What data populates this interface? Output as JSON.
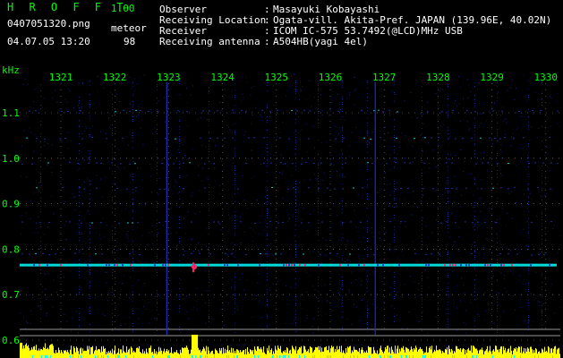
{
  "header": {
    "app_title": "H R O F F T",
    "version": "1.00",
    "filename": "0407051320.png",
    "datetime": "04.07.05 13:20",
    "event_type": "meteor",
    "event_count": "98",
    "info": [
      {
        "label": "Observer",
        "value": "Masayuki Kobayashi"
      },
      {
        "label": "Receiving Location",
        "value": "Ogata-vill. Akita-Pref. JAPAN (139.96E, 40.02N)"
      },
      {
        "label": "Receiver",
        "value": "ICOM IC-575 53.7492(@LCD)MHz USB"
      },
      {
        "label": "Receiving antenna",
        "value": "A504HB(yagi 4el)"
      }
    ],
    "separator": ":"
  },
  "chart_data": {
    "type": "heatmap",
    "x_unit": "time (HHMM)",
    "x_ticks": [
      "1321",
      "1322",
      "1323",
      "1324",
      "1325",
      "1326",
      "1327",
      "1328",
      "1329",
      "1330"
    ],
    "y_unit": "kHz",
    "y_ticks": [
      "1.1",
      "1.0",
      "0.9",
      "0.8",
      "0.7",
      "0.6"
    ],
    "ylim": [
      0.6,
      1.16
    ],
    "carrier_khz": 0.765,
    "meteor_echo_times": [
      "1323",
      "1327"
    ],
    "colors": {
      "background": "#000000",
      "grid": "#ffffff",
      "signal_low": "#2233cc",
      "signal_mid": "#00ffff",
      "signal_high": "#ff2266",
      "level_bar": "#ffff00",
      "text": "#00ff00"
    }
  }
}
